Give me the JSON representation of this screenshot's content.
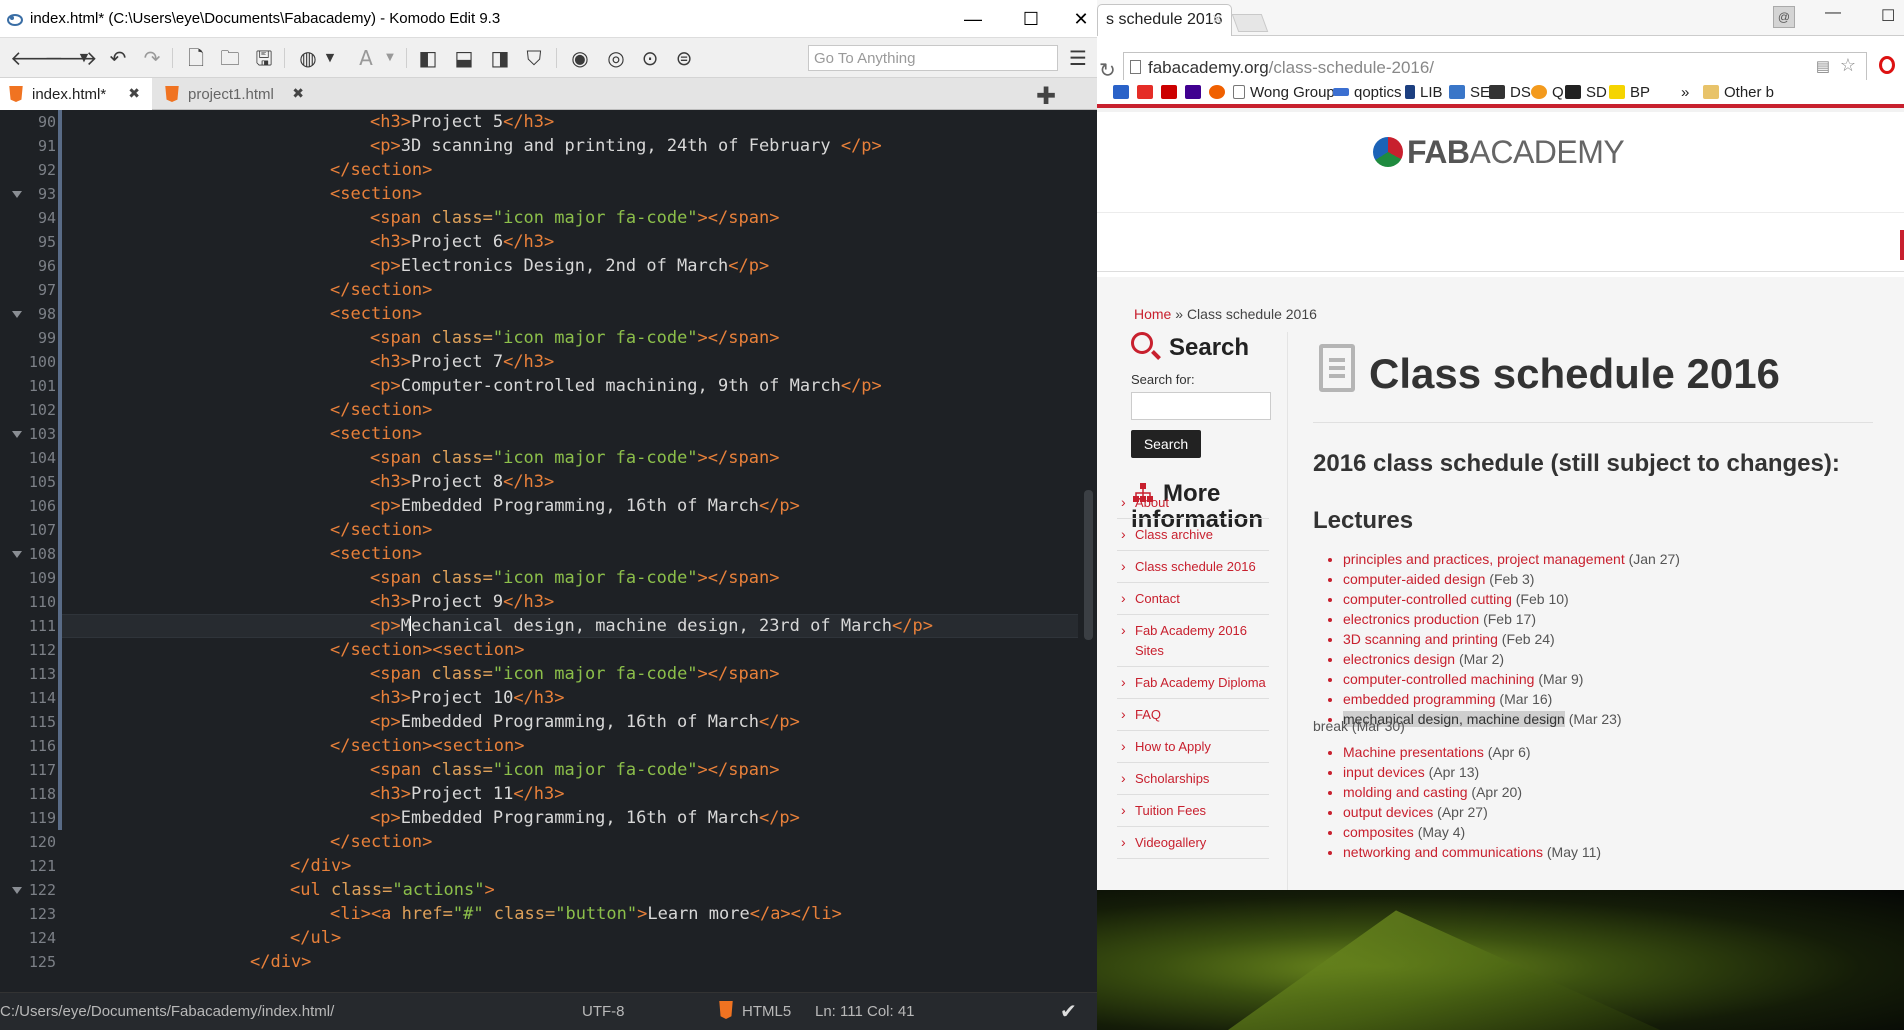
{
  "editor": {
    "title": "index.html* (C:\\Users\\eye\\Documents\\Fabacademy) - Komodo Edit 9.3",
    "goto_placeholder": "Go To Anything",
    "tabs": [
      {
        "label": "index.html*"
      },
      {
        "label": "project1.html"
      }
    ],
    "line_numbers": [
      "90",
      "91",
      "92",
      "93",
      "94",
      "95",
      "96",
      "97",
      "98",
      "99",
      "100",
      "101",
      "102",
      "103",
      "104",
      "105",
      "106",
      "107",
      "108",
      "109",
      "110",
      "111",
      "112",
      "113",
      "114",
      "115",
      "116",
      "117",
      "118",
      "119",
      "120",
      "121",
      "122",
      "123",
      "124",
      "125"
    ],
    "status": {
      "path": "C:/Users/eye/Documents/Fabacademy/index.html/",
      "encoding": "UTF-8",
      "language": "HTML5",
      "position": "Ln: 111 Col: 41"
    }
  },
  "browser": {
    "tab_title": "s schedule 2016",
    "url_domain": "fabacademy.org",
    "url_path": "/class-schedule-2016/",
    "bookmarks": [
      "Wong Group",
      "qoptics",
      "LIB",
      "SE",
      "DS",
      "Q",
      "SD",
      "BP",
      "Other b"
    ],
    "logo_bold": "FAB",
    "logo_light": "ACADEMY",
    "breadcrumb_home": "Home",
    "breadcrumb_sep": " » ",
    "breadcrumb_current": "Class schedule 2016",
    "search_heading": "Search",
    "search_for_label": "Search for:",
    "search_button": "Search",
    "more_info_heading": "More information",
    "side_links": [
      "About",
      "Class archive",
      "Class schedule 2016",
      "Contact",
      "Fab Academy 2016 Sites",
      "Fab Academy Diploma",
      "FAQ",
      "How to Apply",
      "Scholarships",
      "Tuition Fees",
      "Videogallery"
    ],
    "page_title": "Class schedule 2016",
    "subtitle": "2016 class schedule (still subject to changes):",
    "lectures_heading": "Lectures",
    "lectures": [
      {
        "link": "principles and practices, project management",
        "date": "(Jan 27)"
      },
      {
        "link": "computer-aided design",
        "date": "(Feb 3)"
      },
      {
        "link": "computer-controlled cutting",
        "date": "(Feb 10)"
      },
      {
        "link": "electronics production",
        "date": "(Feb 17)"
      },
      {
        "link": "3D scanning and printing",
        "date": "(Feb 24)"
      },
      {
        "link": "electronics design",
        "date": "(Mar 2)"
      },
      {
        "link": "computer-controlled machining",
        "date": "(Mar 9)"
      },
      {
        "link": "embedded programming",
        "date": "(Mar 16)"
      },
      {
        "link": "mechanical design, machine design",
        "date": "(Mar 23)"
      }
    ],
    "break_text": "break (Mar 30)",
    "lectures2": [
      {
        "link": "Machine presentations",
        "date": "(Apr 6)"
      },
      {
        "link": "input devices",
        "date": "(Apr 13)"
      },
      {
        "link": "molding and casting",
        "date": "(Apr 20)"
      },
      {
        "link": "output devices",
        "date": "(Apr 27)"
      },
      {
        "link": "composites",
        "date": "(May 4)"
      },
      {
        "link": "networking and communications",
        "date": "(May 11)"
      }
    ]
  }
}
